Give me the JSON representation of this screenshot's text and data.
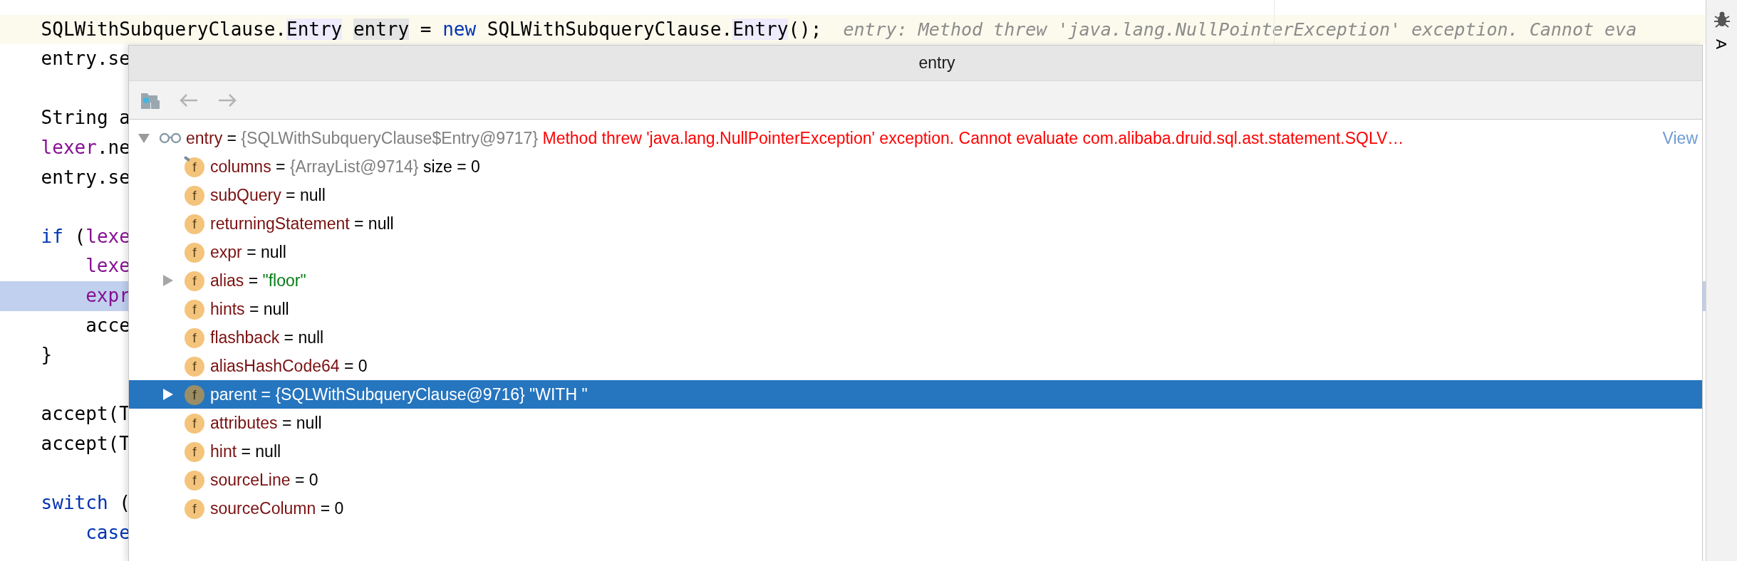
{
  "editor": {
    "lines": [
      {
        "children": [
          {
            "current": true,
            "selected": false,
            "tokens": [
              {
                "text": "SQLWithSubqueryClause.",
                "kind": "plain"
              },
              {
                "text": "Entry",
                "kind": "reference"
              },
              {
                "text": "entry",
                "kind": "usage"
              },
              {
                "text": " = ",
                "kind": "plain"
              },
              {
                "text": "new",
                "kind": "keyword"
              },
              {
                "text": " SQLWithSubqueryClause.",
                "kind": "plain"
              },
              {
                "text": "Entry",
                "kind": "reference"
              },
              {
                "text": "();",
                "kind": "plain"
              }
            ],
            "hint": "entry: Method threw 'java.lang.NullPointerException' exception. Cannot eva"
          },
          {
            "current": false,
            "selected": false,
            "tokens": [
              {
                "text": "entry.se",
                "kind": "plain"
              }
            ]
          },
          {
            "gap_before": true,
            "current": false,
            "selected": false,
            "tokens": [
              {
                "text": "String a",
                "kind": "plain"
              }
            ]
          },
          {
            "current": false,
            "selected": false,
            "tokens": [
              {
                "text": "lexer",
                "kind": "field"
              },
              {
                "text": ".ne",
                "kind": "plain"
              }
            ]
          },
          {
            "current": false,
            "selected": false,
            "tokens": [
              {
                "text": "entry.se",
                "kind": "plain"
              }
            ]
          },
          {
            "gap_before": true,
            "current": false,
            "selected": false,
            "tokens": [
              {
                "text": "if",
                "kind": "keyword"
              },
              {
                "text": " (",
                "kind": "plain"
              },
              {
                "text": "lexe",
                "kind": "field"
              }
            ],
            "children": [
              {
                "current": false,
                "selected": false,
                "tokens": [
                  {
                    "text": "lexe",
                    "kind": "field"
                  }
                ]
              },
              {
                "current": false,
                "selected": true,
                "tokens": [
                  {
                    "text": "expr",
                    "kind": "field"
                  }
                ]
              },
              {
                "current": false,
                "selected": false,
                "tokens": [
                  {
                    "text": "acce",
                    "kind": "plain"
                  }
                ]
              }
            ]
          },
          {
            "current": false,
            "selected": false,
            "tokens": [
              {
                "text": "}",
                "kind": "plain"
              }
            ]
          },
          {
            "gap_before": true,
            "current": false,
            "selected": false,
            "tokens": [
              {
                "text": "accept(T",
                "kind": "plain"
              }
            ]
          },
          {
            "current": false,
            "selected": false,
            "tokens": [
              {
                "text": "accept(T",
                "kind": "plain"
              }
            ]
          },
          {
            "gap_before": true,
            "current": false,
            "selected": false,
            "tokens": [
              {
                "text": "switch",
                "kind": "keyword"
              },
              {
                "text": " (",
                "kind": "plain"
              }
            ],
            "children": [
              {
                "current": false,
                "selected": false,
                "tokens": [
                  {
                    "text": "case",
                    "kind": "keyword"
                  }
                ]
              }
            ]
          }
        ]
      }
    ]
  },
  "side_strip": {
    "label": "A"
  },
  "popup": {
    "title": "entry",
    "root": {
      "name": "entry",
      "op": "=",
      "ref": "{SQLWithSubqueryClause$Entry@9717}",
      "error": "Method threw 'java.lang.NullPointerException' exception. Cannot evaluate com.alibaba.druid.sql.ast.statement.SQLV…",
      "link": "View",
      "expanded": true,
      "children": [
        {
          "icon": "f",
          "marked": true,
          "expandable": false,
          "selected": false,
          "kind": "plain",
          "name": "columns",
          "op": "=",
          "ref": "{ArrayList@9714}",
          "value": "size = 0"
        },
        {
          "icon": "f",
          "marked": false,
          "expandable": false,
          "selected": false,
          "kind": "plain",
          "name": "subQuery",
          "op": "=",
          "value": "null"
        },
        {
          "icon": "f",
          "marked": false,
          "expandable": false,
          "selected": false,
          "kind": "plain",
          "name": "returningStatement",
          "op": "=",
          "value": "null"
        },
        {
          "icon": "f",
          "marked": false,
          "expandable": false,
          "selected": false,
          "kind": "plain",
          "name": "expr",
          "op": "=",
          "value": "null"
        },
        {
          "icon": "f",
          "marked": false,
          "expandable": true,
          "selected": false,
          "kind": "string",
          "name": "alias",
          "op": "=",
          "value": "\"floor\""
        },
        {
          "icon": "f",
          "marked": false,
          "expandable": false,
          "selected": false,
          "kind": "plain",
          "name": "hints",
          "op": "=",
          "value": "null"
        },
        {
          "icon": "f",
          "marked": false,
          "expandable": false,
          "selected": false,
          "kind": "plain",
          "name": "flashback",
          "op": "=",
          "value": "null"
        },
        {
          "icon": "f",
          "marked": false,
          "expandable": false,
          "selected": false,
          "kind": "plain",
          "name": "aliasHashCode64",
          "op": "=",
          "value": "0"
        },
        {
          "icon": "f",
          "marked": false,
          "expandable": true,
          "selected": true,
          "kind": "string",
          "name": "parent",
          "op": "=",
          "ref": "{SQLWithSubqueryClause@9716}",
          "value": "\"WITH \""
        },
        {
          "icon": "f",
          "marked": false,
          "expandable": false,
          "selected": false,
          "kind": "plain",
          "name": "attributes",
          "op": "=",
          "value": "null"
        },
        {
          "icon": "f",
          "marked": false,
          "expandable": false,
          "selected": false,
          "kind": "plain",
          "name": "hint",
          "op": "=",
          "value": "null"
        },
        {
          "icon": "f",
          "marked": false,
          "expandable": false,
          "selected": false,
          "kind": "plain",
          "name": "sourceLine",
          "op": "=",
          "value": "0"
        },
        {
          "icon": "f",
          "marked": false,
          "expandable": false,
          "selected": false,
          "kind": "plain",
          "name": "sourceColumn",
          "op": "=",
          "value": "0"
        }
      ]
    }
  }
}
